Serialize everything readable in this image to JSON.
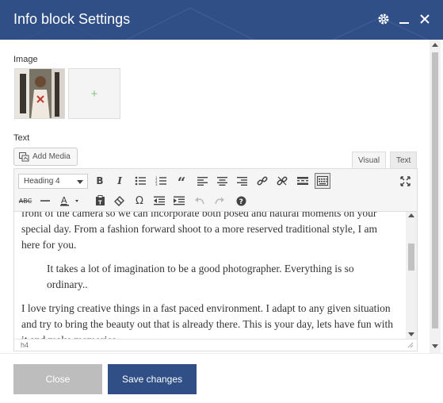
{
  "dialog": {
    "title": "Info block Settings"
  },
  "image_section": {
    "label": "Image",
    "add_symbol": "+"
  },
  "text_section": {
    "label": "Text",
    "add_media_label": "Add Media",
    "tabs": [
      "Visual",
      "Text"
    ],
    "active_tab": "Visual",
    "format_select": "Heading 4",
    "toolbar_row1": [
      "bold-icon",
      "italic-icon",
      "bullet-list-icon",
      "numbered-list-icon",
      "blockquote-icon",
      "align-left-icon",
      "align-center-icon",
      "align-right-icon",
      "link-icon",
      "unlink-icon",
      "read-more-icon",
      "toolbar-toggle-icon",
      "fullscreen-icon"
    ],
    "toolbar_row2": [
      "strikethrough-icon",
      "horizontal-line-icon",
      "text-color-icon",
      "paste-as-text-icon",
      "clear-formatting-icon",
      "special-character-icon",
      "outdent-icon",
      "indent-icon",
      "undo-icon",
      "redo-icon",
      "help-icon"
    ],
    "content": {
      "p1": "front of the camera so we can incorporate both posed and natural moments on your special day. From a fashion forward shoot to a more reserved traditional style, I am here for you.",
      "quote": "It takes a lot of imagination to be a good photographer. Everything is so ordinary..",
      "p2": "I love trying creative things in a fast paced environment. I adapt to any given situation and try to bring the beauty out that is already there. This is your day, lets have fun with it and make memories."
    },
    "status_path": "h4"
  },
  "footer": {
    "close_label": "Close",
    "save_label": "Save changes"
  },
  "colors": {
    "header": "#2f4f86",
    "save_button": "#2f4f86",
    "close_button": "#bdbdbd",
    "add_plus": "#7fc77f"
  }
}
